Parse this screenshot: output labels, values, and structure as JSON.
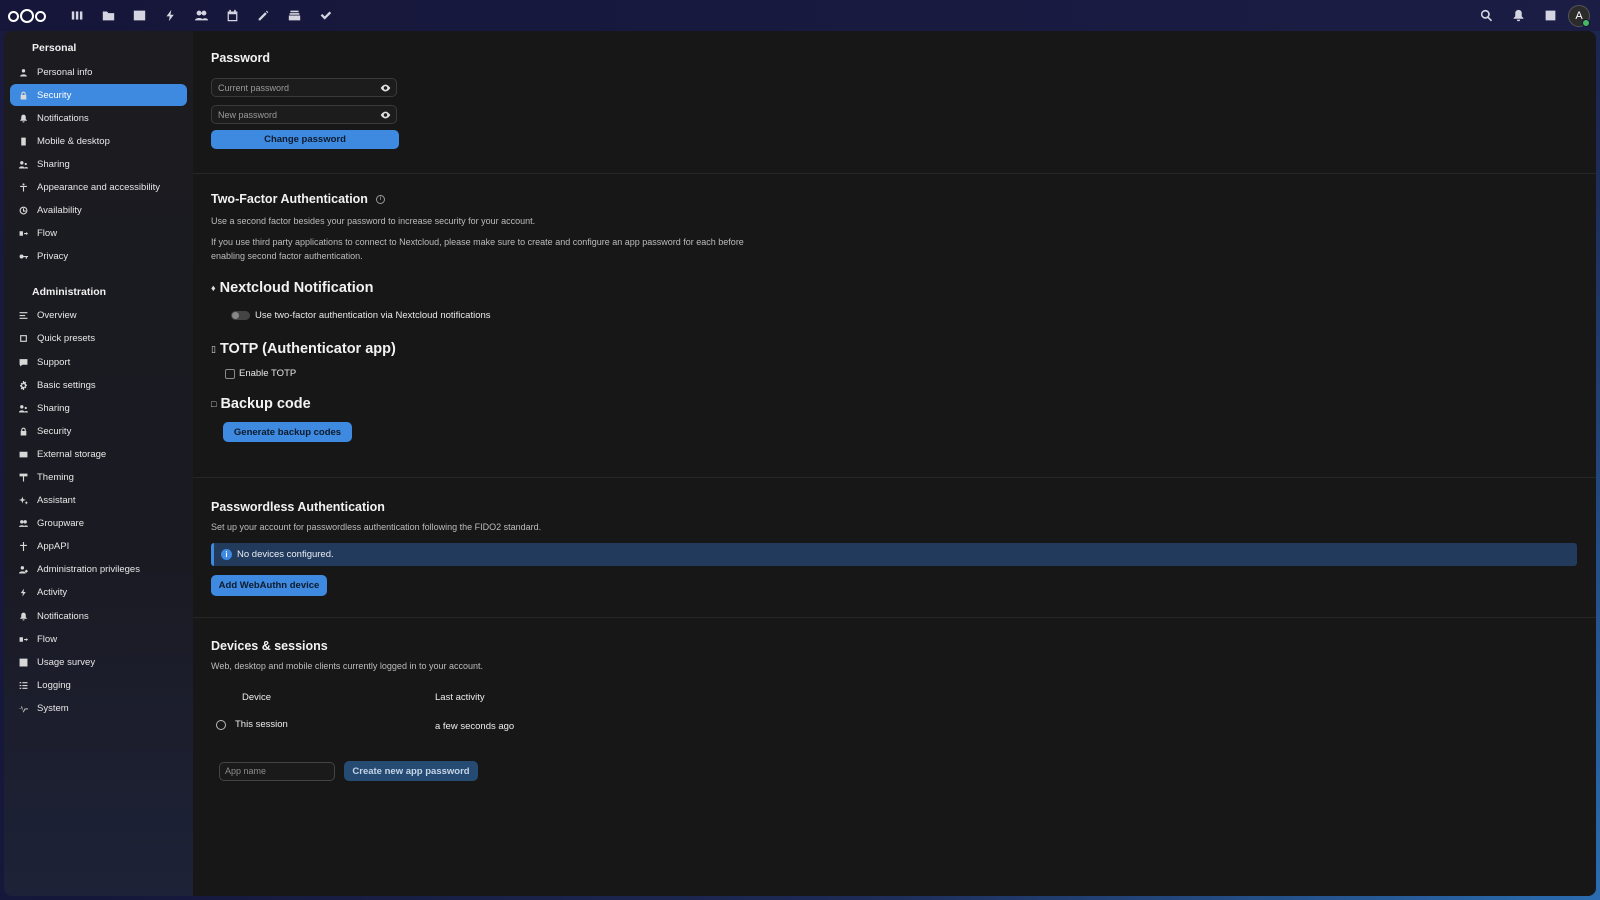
{
  "topbar": {
    "apps": [
      "dashboard-icon",
      "files-icon",
      "photos-icon",
      "activity-icon",
      "contacts-icon",
      "calendar-icon",
      "notes-icon",
      "deck-icon",
      "tasks-icon"
    ],
    "avatar_letter": "A"
  },
  "sidebar": {
    "personal_title": "Personal",
    "personal_items": [
      {
        "label": "Personal info",
        "icon": "user-icon"
      },
      {
        "label": "Security",
        "icon": "lock-icon",
        "active": true
      },
      {
        "label": "Notifications",
        "icon": "bell-icon"
      },
      {
        "label": "Mobile & desktop",
        "icon": "phone-icon"
      },
      {
        "label": "Sharing",
        "icon": "share-icon"
      },
      {
        "label": "Appearance and accessibility",
        "icon": "accessibility-icon"
      },
      {
        "label": "Availability",
        "icon": "clock-icon"
      },
      {
        "label": "Flow",
        "icon": "flow-icon"
      },
      {
        "label": "Privacy",
        "icon": "key-icon"
      }
    ],
    "admin_title": "Administration",
    "admin_items": [
      {
        "label": "Overview",
        "icon": "overview-icon"
      },
      {
        "label": "Quick presets",
        "icon": "presets-icon"
      },
      {
        "label": "Support",
        "icon": "support-icon"
      },
      {
        "label": "Basic settings",
        "icon": "gear-icon"
      },
      {
        "label": "Sharing",
        "icon": "share-icon"
      },
      {
        "label": "Security",
        "icon": "lock-icon"
      },
      {
        "label": "External storage",
        "icon": "storage-icon"
      },
      {
        "label": "Theming",
        "icon": "brush-icon"
      },
      {
        "label": "Assistant",
        "icon": "sparkle-icon"
      },
      {
        "label": "Groupware",
        "icon": "group-icon"
      },
      {
        "label": "AppAPI",
        "icon": "api-icon"
      },
      {
        "label": "Administration privileges",
        "icon": "admin-icon"
      },
      {
        "label": "Activity",
        "icon": "activity-icon"
      },
      {
        "label": "Notifications",
        "icon": "bell-icon"
      },
      {
        "label": "Flow",
        "icon": "flow-icon"
      },
      {
        "label": "Usage survey",
        "icon": "survey-icon"
      },
      {
        "label": "Logging",
        "icon": "list-icon"
      },
      {
        "label": "System",
        "icon": "pulse-icon"
      }
    ]
  },
  "password": {
    "title": "Password",
    "current_placeholder": "Current password",
    "new_placeholder": "New password",
    "change_button": "Change password"
  },
  "twofa": {
    "title": "Two-Factor Authentication",
    "desc1": "Use a second factor besides your password to increase security for your account.",
    "desc2": "If you use third party applications to connect to Nextcloud, please make sure to create and configure an app password for each before enabling second factor authentication.",
    "nc_title": "Nextcloud Notification",
    "nc_toggle_label": "Use two-factor authentication via Nextcloud notifications",
    "totp_title": "TOTP (Authenticator app)",
    "totp_checkbox_label": "Enable TOTP",
    "backup_title": "Backup code",
    "backup_button": "Generate backup codes"
  },
  "passwordless": {
    "title": "Passwordless Authentication",
    "desc": "Set up your account for passwordless authentication following the FIDO2 standard.",
    "info": "No devices configured.",
    "add_button": "Add WebAuthn device"
  },
  "devices": {
    "title": "Devices & sessions",
    "desc": "Web, desktop and mobile clients currently logged in to your account.",
    "col_device": "Device",
    "col_activity": "Last activity",
    "rows": [
      {
        "device": "This session",
        "activity": "a few seconds ago"
      }
    ],
    "app_name_placeholder": "App name",
    "create_button": "Create new app password"
  }
}
